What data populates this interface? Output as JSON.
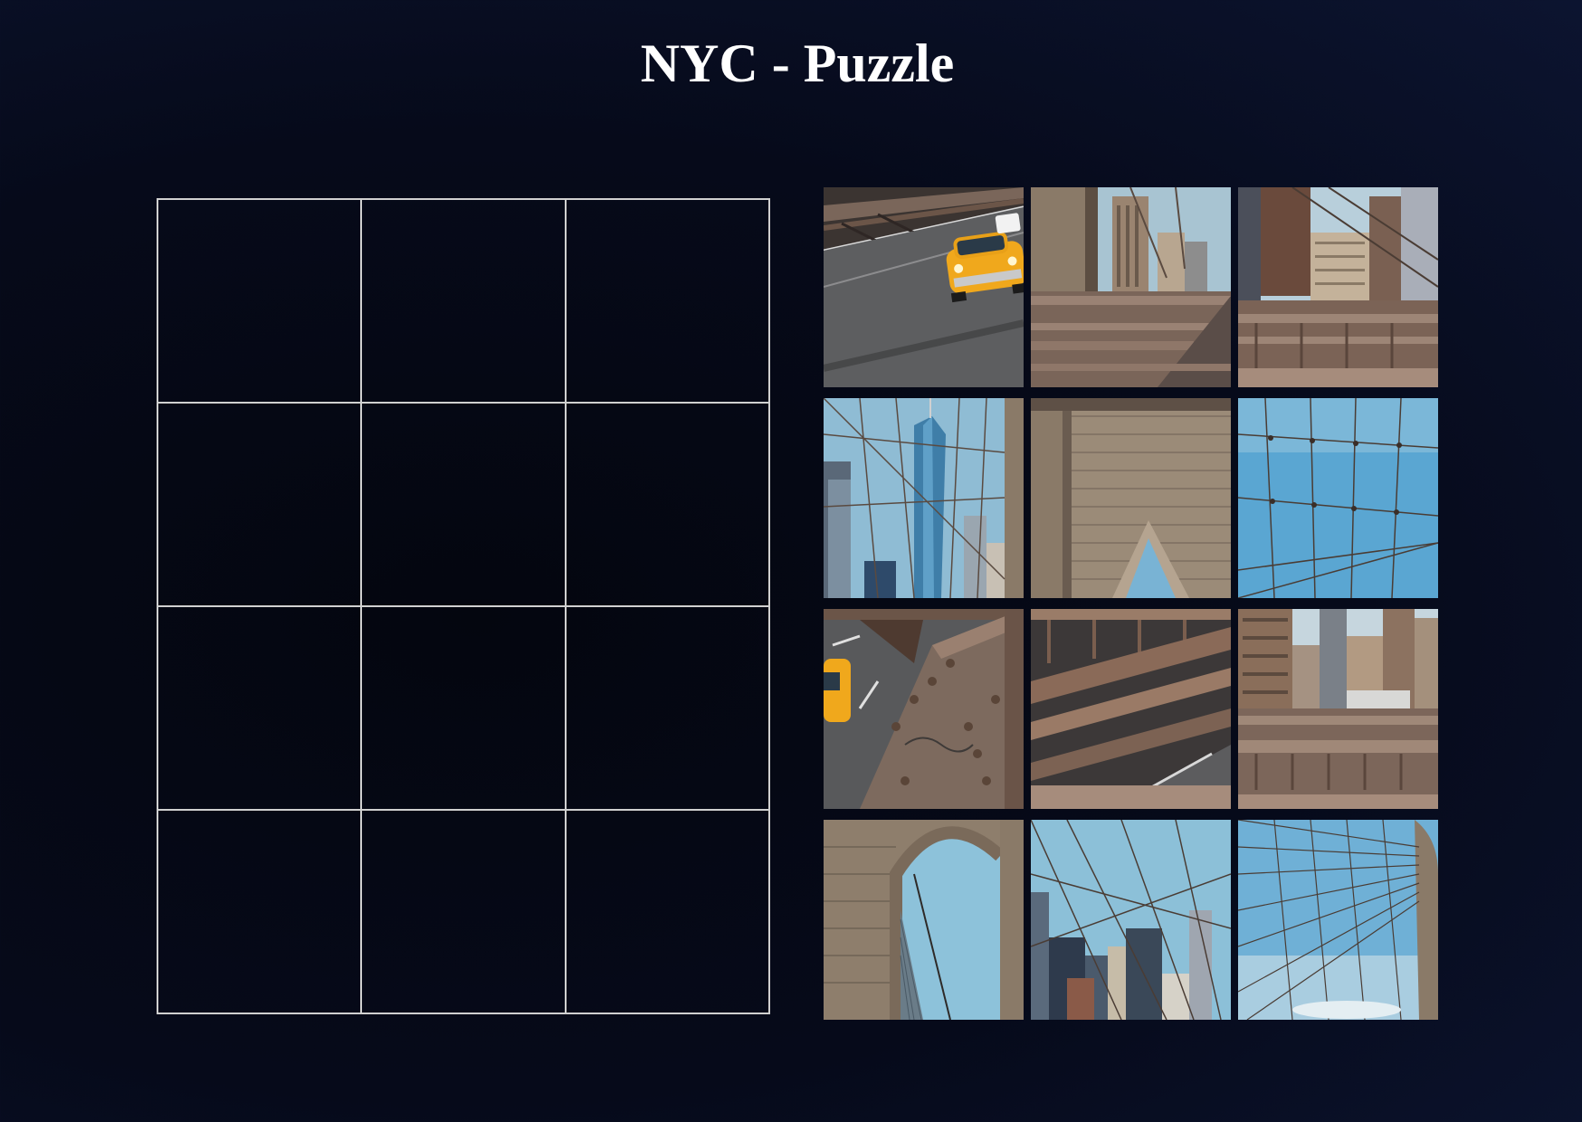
{
  "title": "NYC - Puzzle",
  "board": {
    "rows": 4,
    "cols": 3,
    "slots": [
      "",
      "",
      "",
      "",
      "",
      "",
      "",
      "",
      "",
      "",
      "",
      ""
    ]
  },
  "tray": {
    "pieces": [
      {
        "name": "taxi-on-bridge-road",
        "scene": "taxi-road"
      },
      {
        "name": "bridge-deck-with-buildings",
        "scene": "deck-buildings"
      },
      {
        "name": "skyline-over-bridge-rail",
        "scene": "skyline-rail"
      },
      {
        "name": "one-world-trade-through-cables",
        "scene": "tower-cables"
      },
      {
        "name": "stone-tower-arch-top",
        "scene": "stone-arch-top"
      },
      {
        "name": "sky-with-cable-net",
        "scene": "sky-cables"
      },
      {
        "name": "riveted-steel-beam-with-taxi",
        "scene": "rivet-beam"
      },
      {
        "name": "bridge-railing-road",
        "scene": "railing-road"
      },
      {
        "name": "city-buildings-over-deck",
        "scene": "buildings-deck"
      },
      {
        "name": "stone-arch-with-sky",
        "scene": "arch-sky"
      },
      {
        "name": "skyscrapers-through-cables",
        "scene": "skyscrapers-cables"
      },
      {
        "name": "cables-converging-on-tower",
        "scene": "cables-tower"
      }
    ]
  },
  "colors": {
    "background": "#060a1a",
    "grid_line": "#d0d0d0",
    "title": "#ffffff",
    "sky": "#7fb4cf",
    "stone": "#8a7a68",
    "steel": "#6b5548",
    "road": "#5a5a5c",
    "taxi": "#f0a81c"
  }
}
